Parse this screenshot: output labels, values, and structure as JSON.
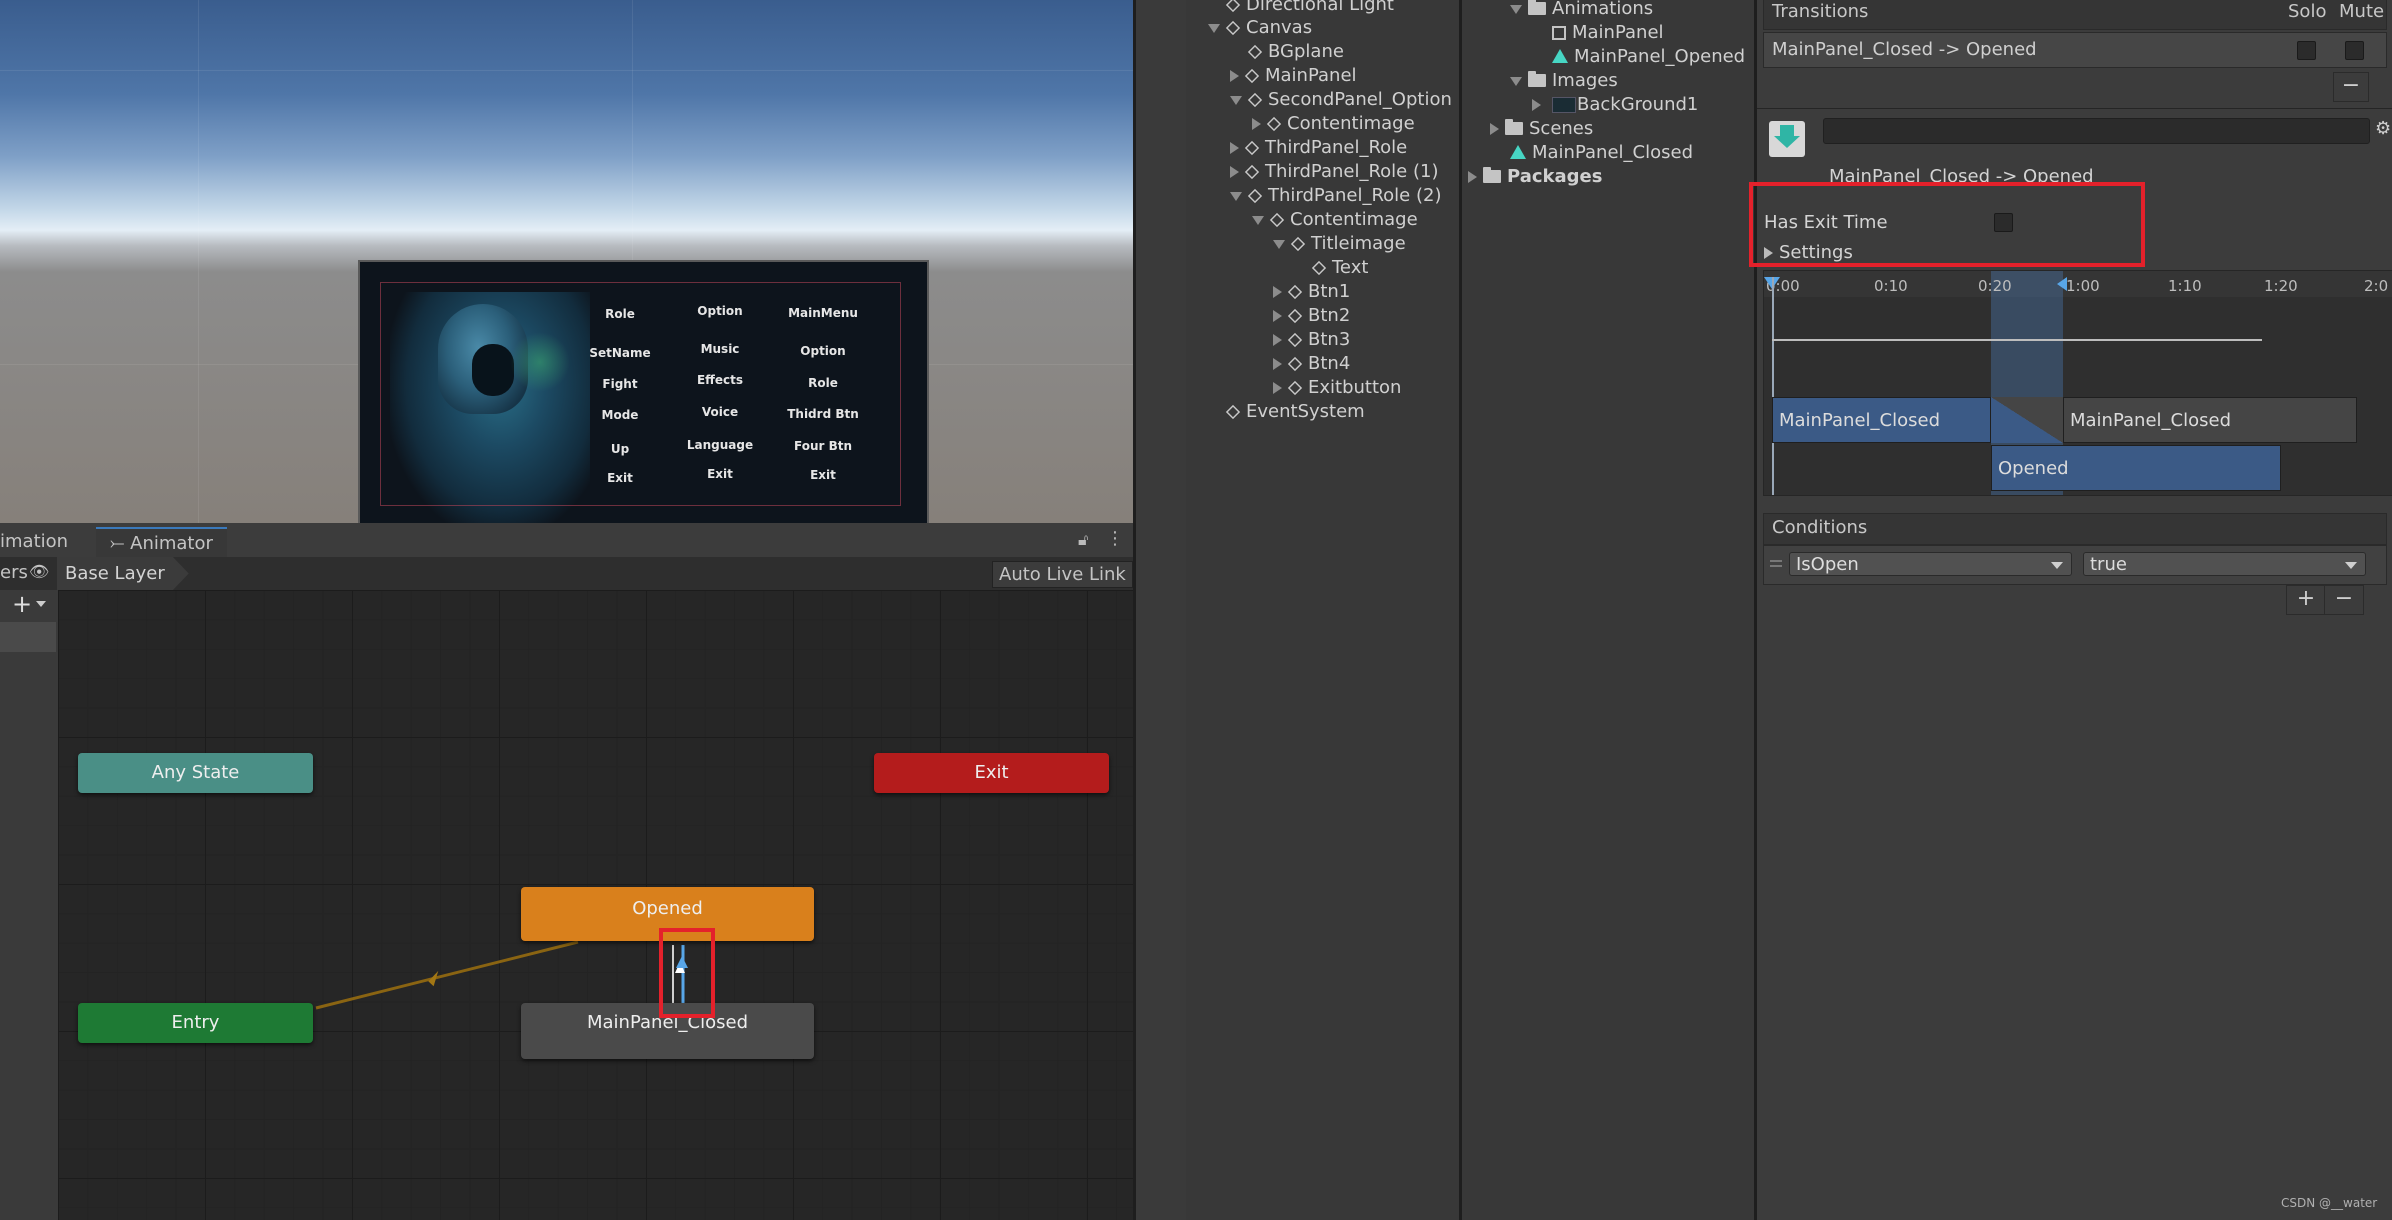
{
  "scene_view": {
    "game_menu": {
      "col1": [
        "Role",
        "SetName",
        "Fight",
        "Mode",
        "Up",
        "Exit"
      ],
      "col2": [
        "Option",
        "Music",
        "Effects",
        "Voice",
        "Language",
        "Exit"
      ],
      "col3": [
        "MainMenu",
        "Option",
        "Role",
        "Thidrd Btn",
        "Four Btn",
        "Exit"
      ]
    }
  },
  "animator": {
    "tab_animation": "imation",
    "tab_animator": "Animator",
    "layers_label": "ers",
    "breadcrumb_layer": "Base Layer",
    "auto_live_link": "Auto Live Link",
    "plus_label": "+",
    "nodes": {
      "any_state": "Any State",
      "exit": "Exit",
      "opened": "Opened",
      "entry": "Entry",
      "main_closed": "MainPanel_Closed"
    },
    "colors": {
      "any_state": "#4a8f86",
      "exit": "#b41c1c",
      "opened": "#d9801c",
      "entry": "#1e7a34",
      "main_closed": "#4a4a4a",
      "transition_line": "#7a5a12",
      "selected_transition": "#58a6e8"
    }
  },
  "hierarchy": {
    "items": [
      "Directional Light",
      "Canvas",
      "BGplane",
      "MainPanel",
      "SecondPanel_Option",
      "Contentimage",
      "ThirdPanel_Role",
      "ThirdPanel_Role (1)",
      "ThirdPanel_Role (2)",
      "Contentimage",
      "Titleimage",
      "Text",
      "Btn1",
      "Btn2",
      "Btn3",
      "Btn4",
      "Exitbutton",
      "EventSystem"
    ]
  },
  "project": {
    "items": [
      "Animations",
      "MainPanel",
      "MainPanel_Opened",
      "Images",
      "BackGround1",
      "Scenes",
      "MainPanel_Closed",
      "Packages"
    ]
  },
  "inspector": {
    "transitions_header": "Transitions",
    "solo": "Solo",
    "mute": "Mute",
    "transition_row": "MainPanel_Closed -> Opened",
    "minus": "−",
    "transition_title": "MainPanel_Closed -> Opened",
    "has_exit_time": "Has Exit Time",
    "settings": "Settings",
    "ruler_ticks": [
      "0:00",
      "0:10",
      "0:20",
      "1:00",
      "1:10",
      "1:20",
      "2:0"
    ],
    "timeline": {
      "source_a": "MainPanel_Closed",
      "source_b": "MainPanel_Closed",
      "dest": "Opened"
    },
    "conditions_header": "Conditions",
    "condition_param": "IsOpen",
    "condition_value": "true",
    "plus": "+",
    "minus2": "−"
  },
  "watermark": "CSDN @__water"
}
